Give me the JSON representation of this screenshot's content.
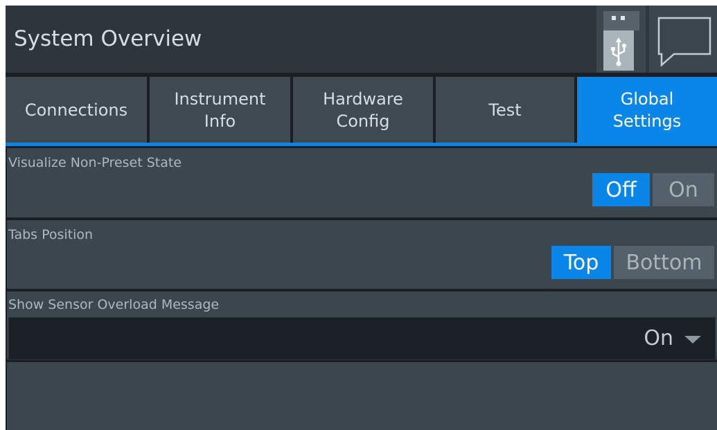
{
  "header": {
    "title": "System Overview",
    "usb_icon": "usb-icon",
    "message_icon": "message-icon"
  },
  "tabs": [
    {
      "label": "Connections",
      "active": false
    },
    {
      "label": "Instrument\nInfo",
      "active": false
    },
    {
      "label": "Hardware\nConfig",
      "active": false
    },
    {
      "label": "Test",
      "active": false
    },
    {
      "label": "Global\nSettings",
      "active": true
    }
  ],
  "settings": {
    "visualize_non_preset": {
      "label": "Visualize Non-Preset State",
      "options": [
        "Off",
        "On"
      ],
      "selected": "Off"
    },
    "tabs_position": {
      "label": "Tabs Position",
      "options": [
        "Top",
        "Bottom"
      ],
      "selected": "Top"
    },
    "sensor_overload": {
      "label": "Show Sensor Overload Message",
      "value": "On"
    }
  },
  "colors": {
    "accent": "#0a86e8",
    "background": "#1b1f23",
    "panel": "#3b464f",
    "text": "#d6dde3"
  }
}
